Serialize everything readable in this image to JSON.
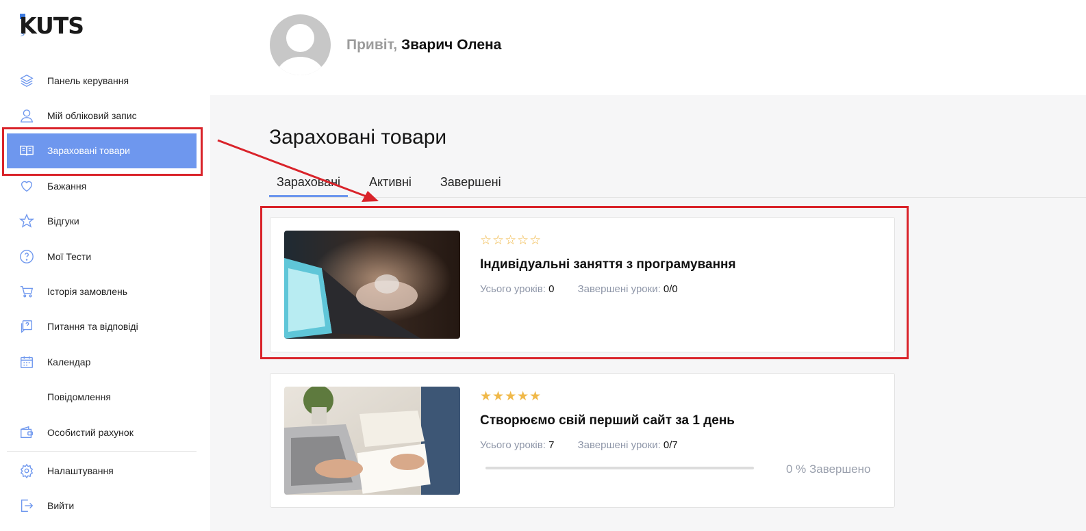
{
  "logo": {
    "text": "KUTS"
  },
  "sidebar": {
    "items": [
      {
        "label": "Панель керування",
        "icon": "layers-icon"
      },
      {
        "label": "Мій обліковий запис",
        "icon": "user-icon"
      },
      {
        "label": "Зараховані товари",
        "icon": "book-icon",
        "active": true
      },
      {
        "label": "Бажання",
        "icon": "heart-icon"
      },
      {
        "label": "Відгуки",
        "icon": "star-icon"
      },
      {
        "label": "Мої Тести",
        "icon": "question-icon"
      },
      {
        "label": "Історія замовлень",
        "icon": "cart-icon"
      },
      {
        "label": "Питання та відповіді",
        "icon": "qa-icon"
      },
      {
        "label": "Календар",
        "icon": "calendar-icon"
      },
      {
        "label": "Повідомлення",
        "icon": ""
      },
      {
        "label": "Особистий рахунок",
        "icon": "wallet-icon"
      },
      {
        "label": "Налаштування",
        "icon": "gear-icon"
      },
      {
        "label": "Вийти",
        "icon": "logout-icon"
      }
    ]
  },
  "header": {
    "greeting": "Привіт,",
    "user_name": "Зварич Олена"
  },
  "main": {
    "title": "Зараховані товари",
    "tabs": [
      {
        "label": "Зараховані",
        "active": true
      },
      {
        "label": "Активні"
      },
      {
        "label": "Завершені"
      }
    ]
  },
  "courses": [
    {
      "stars": "☆☆☆☆☆",
      "rating": 0,
      "title": "Індивідуальні заняття з програмування",
      "total_label": "Усього уроків:",
      "total": "0",
      "done_label": "Завершені уроки:",
      "done": "0/0"
    },
    {
      "stars": "★★★★★",
      "rating": 5,
      "title": "Створюємо свій перший сайт за 1 день",
      "total_label": "Усього уроків:",
      "total": "7",
      "done_label": "Завершені уроки:",
      "done": "0/7",
      "progress_fraction": 0,
      "progress_label": "0 % Завершено"
    }
  ],
  "colors": {
    "accent": "#6e97ee",
    "highlight": "#d9232a",
    "star": "#f0b94a"
  }
}
